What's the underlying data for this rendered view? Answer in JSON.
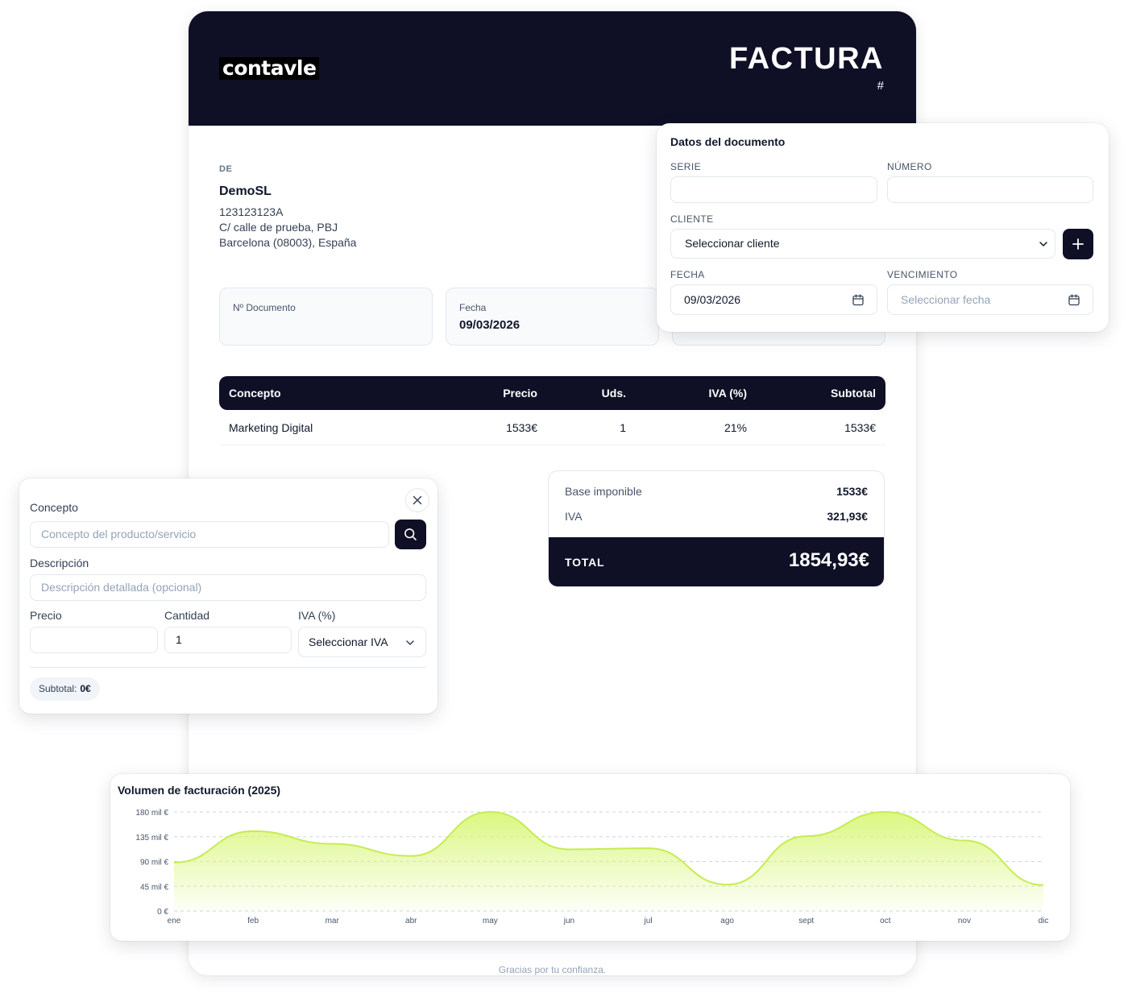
{
  "invoice": {
    "logo_text": "contavle",
    "title": "FACTURA",
    "number_symbol": "#",
    "from": {
      "label": "DE",
      "name": "DemoSL",
      "tax_id": "123123123A",
      "address_line": "C/ calle de prueba, PBJ",
      "city_line": "Barcelona (08003), España"
    },
    "meta": [
      {
        "label": "Nº Documento",
        "value": ""
      },
      {
        "label": "Fecha",
        "value": "09/03/2026"
      }
    ],
    "table": {
      "headers": {
        "concept": "Concepto",
        "price": "Precio",
        "units": "Uds.",
        "vat": "IVA (%)",
        "subtotal": "Subtotal"
      },
      "rows": [
        {
          "concept": "Marketing Digital",
          "price": "1533€",
          "units": "1",
          "vat": "21%",
          "subtotal": "1533€"
        }
      ]
    },
    "totals": {
      "base_label": "Base imponible",
      "base_value": "1533€",
      "vat_label": "IVA",
      "vat_value": "321,93€",
      "total_label": "TOTAL",
      "total_value": "1854,93€"
    },
    "footer": "Gracias por tu confianza."
  },
  "document_panel": {
    "title": "Datos del documento",
    "serie_label": "SERIE",
    "serie_value": "",
    "numero_label": "NÚMERO",
    "numero_value": "",
    "cliente_label": "CLIENTE",
    "cliente_value": "Seleccionar cliente",
    "fecha_label": "FECHA",
    "fecha_value": "09/03/2026",
    "vencimiento_label": "VENCIMIENTO",
    "vencimiento_placeholder": "Seleccionar fecha"
  },
  "concept_panel": {
    "concept_label": "Concepto",
    "concept_placeholder": "Concepto del producto/servicio",
    "description_label": "Descripción",
    "description_placeholder": "Descripción detallada (opcional)",
    "price_label": "Precio",
    "price_value": "",
    "quantity_label": "Cantidad",
    "quantity_value": "1",
    "vat_label": "IVA (%)",
    "vat_value": "Seleccionar IVA",
    "subtotal_label": "Subtotal:",
    "subtotal_value": "0€"
  },
  "colors": {
    "dark": "#0f1026",
    "chart_fill": "#d9f77a",
    "chart_line": "#c6ec52"
  },
  "chart_data": {
    "type": "area",
    "title": "Volumen de facturación (2025)",
    "categories": [
      "ene",
      "feb",
      "mar",
      "abr",
      "may",
      "jun",
      "jul",
      "ago",
      "sept",
      "oct",
      "nov",
      "dic"
    ],
    "series": [
      {
        "values": [
          88000,
          145000,
          122000,
          100000,
          180000,
          112000,
          114000,
          48000,
          136000,
          180000,
          128000,
          47000
        ]
      }
    ],
    "ylim": [
      0,
      180000
    ],
    "ytick_values": [
      0,
      45000,
      90000,
      135000,
      180000
    ],
    "ytick_labels": [
      "0 €",
      "45 mil €",
      "90 mil €",
      "135 mil €",
      "180 mil €"
    ],
    "grid": true,
    "legend": "none"
  }
}
